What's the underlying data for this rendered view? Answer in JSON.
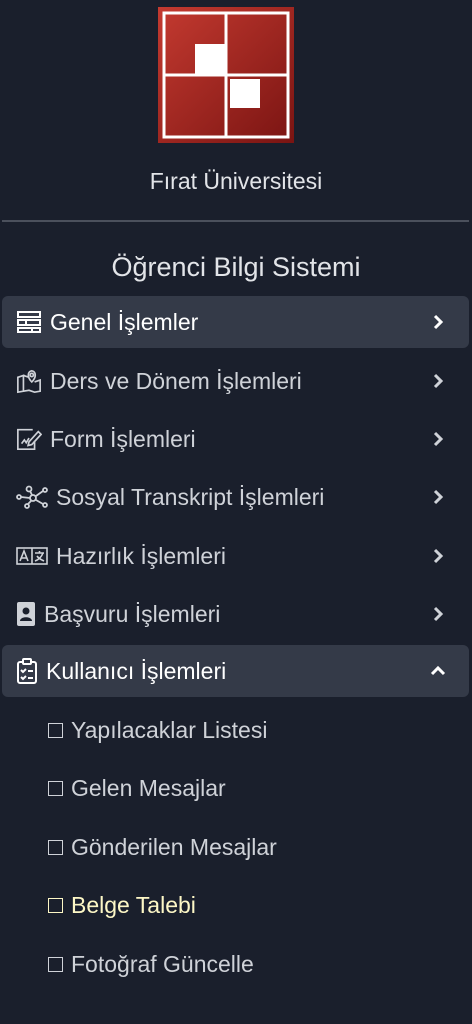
{
  "brand": {
    "name": "Fırat Üniversitesi"
  },
  "system_title": "Öğrenci Bilgi Sistemi",
  "colors": {
    "background": "#1a1f2c",
    "active_bg": "#343a48",
    "logo_red": "#a82825",
    "highlight_text": "#fdf7c6"
  },
  "menu": [
    {
      "label": "Genel İşlemler",
      "icon": "table-icon",
      "active": true,
      "expanded": false
    },
    {
      "label": "Ders ve Dönem İşlemleri",
      "icon": "map-pin-icon",
      "active": false,
      "expanded": false
    },
    {
      "label": "Form İşlemleri",
      "icon": "form-edit-icon",
      "active": false,
      "expanded": false
    },
    {
      "label": "Sosyal Transkript İşlemleri",
      "icon": "network-icon",
      "active": false,
      "expanded": false
    },
    {
      "label": "Hazırlık İşlemleri",
      "icon": "translate-icon",
      "active": false,
      "expanded": false
    },
    {
      "label": "Başvuru İşlemleri",
      "icon": "id-badge-icon",
      "active": false,
      "expanded": false
    },
    {
      "label": "Kullanıcı İşlemleri",
      "icon": "clipboard-check-icon",
      "active": true,
      "expanded": true
    }
  ],
  "submenu": [
    {
      "label": "Yapılacaklar Listesi",
      "highlighted": false
    },
    {
      "label": "Gelen Mesajlar",
      "highlighted": false
    },
    {
      "label": "Gönderilen Mesajlar",
      "highlighted": false
    },
    {
      "label": "Belge Talebi",
      "highlighted": true
    },
    {
      "label": "Fotoğraf Güncelle",
      "highlighted": false
    }
  ]
}
